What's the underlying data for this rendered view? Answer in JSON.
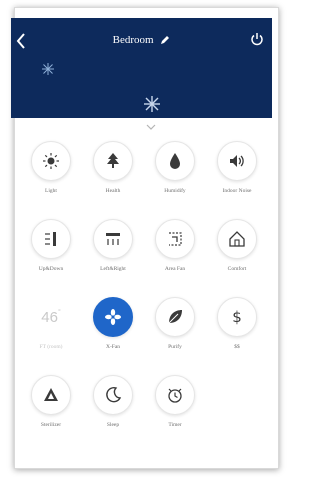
{
  "header": {
    "title": "Bedroom",
    "background": "#0d2a5c"
  },
  "controls": {
    "row1": [
      {
        "label": "Light",
        "icon": "light-icon"
      },
      {
        "label": "Health",
        "icon": "tree-icon"
      },
      {
        "label": "Humidify",
        "icon": "droplet-icon"
      },
      {
        "label": "Indoor Noise",
        "icon": "speaker-icon"
      }
    ],
    "row2": [
      {
        "label": "Up&Down",
        "icon": "vertical-swing-icon"
      },
      {
        "label": "Left&Right",
        "icon": "horizontal-swing-icon"
      },
      {
        "label": "Area Fan",
        "icon": "area-fan-icon"
      },
      {
        "label": "Comfort",
        "icon": "home-icon"
      }
    ],
    "row3": [
      {
        "label": "FT (room)",
        "value": "46",
        "unit": "°",
        "icon": "temperature-display"
      },
      {
        "label": "X-Fan",
        "icon": "fan-icon"
      },
      {
        "label": "Purify",
        "icon": "leaf-icon"
      },
      {
        "label": "$$",
        "icon": "dollar-icon"
      }
    ],
    "row4": [
      {
        "label": "Sterilizer",
        "icon": "sterilize-icon"
      },
      {
        "label": "Sleep",
        "icon": "moon-icon"
      },
      {
        "label": "Timer",
        "icon": "alarm-clock-icon"
      }
    ]
  },
  "colors": {
    "active": "#1f66c9",
    "icon": "#3a3a3a",
    "label": "#6f6f6f"
  }
}
